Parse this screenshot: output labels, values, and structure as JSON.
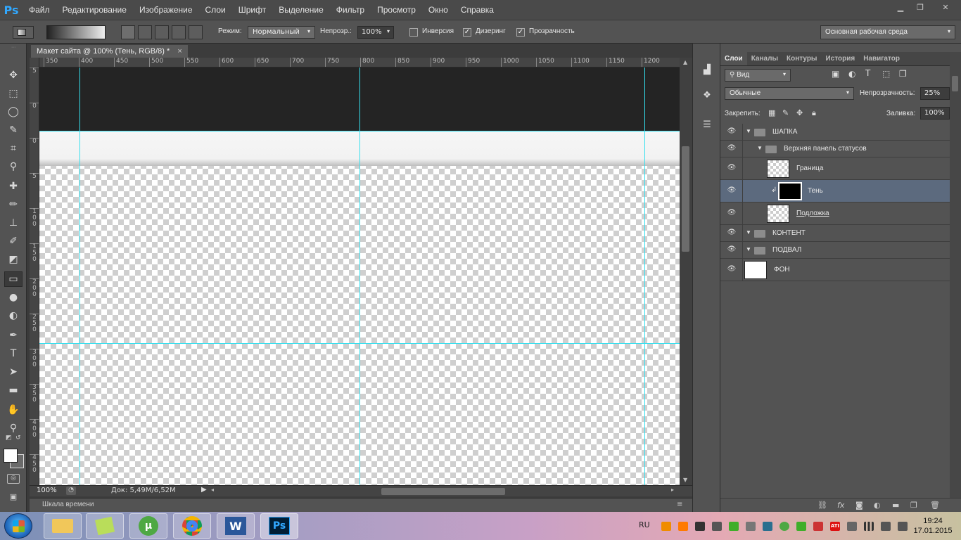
{
  "app": {
    "logo": "Ps",
    "menu": [
      "Файл",
      "Редактирование",
      "Изображение",
      "Слои",
      "Шрифт",
      "Выделение",
      "Фильтр",
      "Просмотр",
      "Окно",
      "Справка"
    ],
    "window_buttons": {
      "minimize": "▁",
      "restore": "❐",
      "close": "✕"
    }
  },
  "options_bar": {
    "mode_label": "Режим:",
    "mode_value": "Нормальный",
    "opacity_label": "Непрозр.:",
    "opacity_value": "100%",
    "inverse_label": "Инверсия",
    "inverse_checked": false,
    "dither_label": "Дизеринг",
    "dither_checked": true,
    "transparency_label": "Прозрачность",
    "transparency_checked": true,
    "workspace": "Основная рабочая среда"
  },
  "tools": [
    {
      "name": "move-tool-icon",
      "glyph": "✥"
    },
    {
      "name": "marquee-tool-icon",
      "glyph": "⬚"
    },
    {
      "name": "lasso-tool-icon",
      "glyph": "◯"
    },
    {
      "name": "quick-select-tool-icon",
      "glyph": "✎"
    },
    {
      "name": "crop-tool-icon",
      "glyph": "⌗"
    },
    {
      "name": "eyedropper-tool-icon",
      "glyph": "⚲"
    },
    {
      "name": "healing-tool-icon",
      "glyph": "✚"
    },
    {
      "name": "brush-tool-icon",
      "glyph": "✏"
    },
    {
      "name": "stamp-tool-icon",
      "glyph": "⊥"
    },
    {
      "name": "history-brush-tool-icon",
      "glyph": "✐"
    },
    {
      "name": "eraser-tool-icon",
      "glyph": "◩"
    },
    {
      "name": "gradient-tool-icon",
      "glyph": "▭"
    },
    {
      "name": "blur-tool-icon",
      "glyph": "●"
    },
    {
      "name": "dodge-tool-icon",
      "glyph": "◐"
    },
    {
      "name": "pen-tool-icon",
      "glyph": "✒"
    },
    {
      "name": "type-tool-icon",
      "glyph": "T"
    },
    {
      "name": "path-select-tool-icon",
      "glyph": "➤"
    },
    {
      "name": "rectangle-tool-icon",
      "glyph": "▬"
    },
    {
      "name": "hand-tool-icon",
      "glyph": "✋"
    },
    {
      "name": "zoom-tool-icon",
      "glyph": "⚲"
    }
  ],
  "document": {
    "tab_title": "Макет сайта @ 100% (Тень, RGB/8) *",
    "tab_close": "×",
    "zoom": "100%",
    "doc_info": "Док: 5,49M/6,52M",
    "ruler_top": [
      "350",
      "400",
      "450",
      "500",
      "550",
      "600",
      "650",
      "700",
      "750",
      "800",
      "850",
      "900",
      "950",
      "1000",
      "1050",
      "1100",
      "1150",
      "1200"
    ],
    "ruler_left": [
      "5",
      "0",
      "0",
      "5",
      "1 0 0",
      "1 5 0",
      "2 0 0",
      "2 5 0",
      "3 0 0",
      "3 5 0",
      "4 0 0",
      "4 5 0"
    ],
    "timeline_label": "Шкала времени"
  },
  "colors": {
    "guide": "#35e0ef",
    "header_dark": "#242424",
    "selected_layer": "#5c6a7e",
    "accent": "#31a8ff"
  },
  "layers_panel": {
    "tabs": [
      "Слои",
      "Каналы",
      "Контуры",
      "История",
      "Навигатор"
    ],
    "filter_label": "Вид",
    "blend_mode": "Обычные",
    "opacity_label": "Непрозрачность:",
    "opacity_value": "25%",
    "lock_label": "Закрепить:",
    "fill_label": "Заливка:",
    "fill_value": "100%",
    "layers": [
      {
        "name": "ШАПКА",
        "type": "group",
        "level": 0
      },
      {
        "name": "Верхняя панель статусов",
        "type": "group",
        "level": 1
      },
      {
        "name": "Граница",
        "type": "layer",
        "level": 2
      },
      {
        "name": "Тень",
        "type": "layer",
        "level": 2,
        "selected": true
      },
      {
        "name": "Подложка",
        "type": "layer",
        "level": 2
      },
      {
        "name": "КОНТЕНТ",
        "type": "group",
        "level": 0
      },
      {
        "name": "ПОДВАЛ",
        "type": "group",
        "level": 0
      },
      {
        "name": "ФОН",
        "type": "layer",
        "level": 0
      }
    ]
  },
  "taskbar": {
    "apps": [
      "",
      "",
      "",
      "",
      "W",
      "Ps"
    ],
    "lang": "RU",
    "time": "19:24",
    "date": "17.01.2015"
  }
}
